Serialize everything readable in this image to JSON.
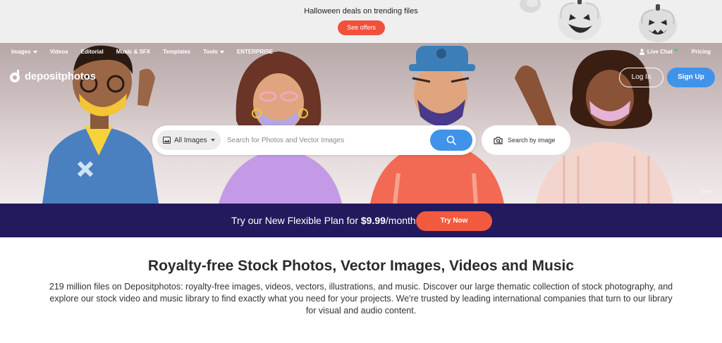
{
  "promo": {
    "text": "Halloween deals on trending files",
    "button": "See offers"
  },
  "nav": {
    "items": [
      {
        "label": "Images",
        "dropdown": true
      },
      {
        "label": "Videos",
        "dropdown": false
      },
      {
        "label": "Editorial",
        "dropdown": false
      },
      {
        "label": "Music & SFX",
        "dropdown": false
      },
      {
        "label": "Templates",
        "dropdown": false
      },
      {
        "label": "Tools",
        "dropdown": true
      },
      {
        "label": "ENTERPRISE",
        "dropdown": false
      }
    ],
    "live_chat": "Live Chat",
    "pricing": "Pricing"
  },
  "brand": {
    "name": "depositphotos"
  },
  "auth": {
    "login": "Log In",
    "signup": "Sign Up"
  },
  "search": {
    "category": "All Images",
    "placeholder": "Search for Photos and Vector Images",
    "by_image": "Search by image"
  },
  "hero": {
    "view_link": "View"
  },
  "plan": {
    "prefix": "Try our New Flexible Plan for ",
    "price": "$9.99",
    "suffix": "/month",
    "button": "Try Now"
  },
  "main": {
    "title": "Royalty-free Stock Photos, Vector Images, Videos and Music",
    "description": "219 million files on Depositphotos: royalty-free images, videos, vectors, illustrations, and music. Discover our large thematic collection of stock photography, and explore our stock video and music library to find exactly what you need for your projects. We're trusted by leading international companies that turn to our library for visual and audio content."
  },
  "colors": {
    "accent_blue": "#3f93e9",
    "accent_orange": "#f15a3f",
    "plan_bg": "#231a5e"
  }
}
